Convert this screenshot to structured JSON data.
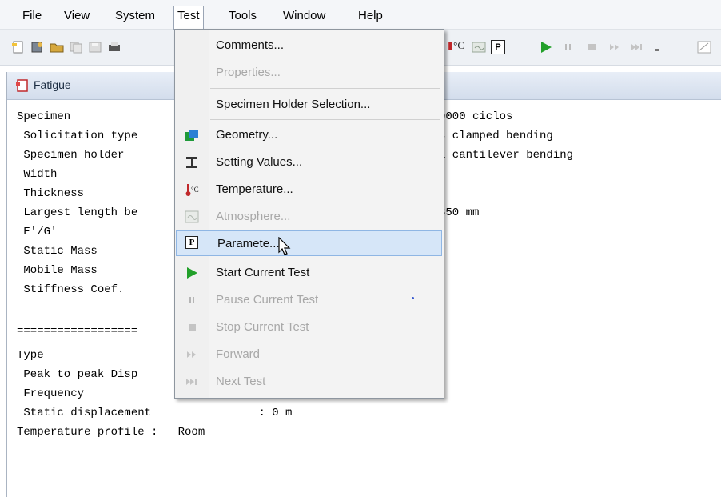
{
  "menubar": {
    "items": [
      "File",
      "View",
      "System",
      "Test",
      "Tools",
      "Window",
      "Help"
    ]
  },
  "document": {
    "title": "Fatigue",
    "lines": [
      "Specimen",
      " Solicitation type",
      " Specimen holder",
      " Width",
      " Thickness",
      " Largest length be",
      " E'/G'",
      " Static Mass",
      " Mobile Mass",
      " Stiffness Coef."
    ],
    "right_lines": [
      "0000 ciclos",
      "s clamped bending",
      "l cantilever bending",
      "",
      "",
      "350 mm"
    ],
    "separator": "==================",
    "lines2": [
      "Type",
      " Peak to peak Disp",
      " Frequency",
      " Static displacement                : 0 m",
      "Temperature profile :   Room"
    ]
  },
  "test_menu": {
    "items": [
      {
        "label": "Comments...",
        "disabled": false,
        "icon": ""
      },
      {
        "label": "Properties...",
        "disabled": true,
        "icon": ""
      },
      {
        "label": "Specimen Holder Selection...",
        "disabled": false,
        "icon": ""
      },
      {
        "label": "Geometry...",
        "disabled": false,
        "icon": "geometry-icon"
      },
      {
        "label": "Setting Values...",
        "disabled": false,
        "icon": "setting-values-icon"
      },
      {
        "label": "Temperature...",
        "disabled": false,
        "icon": "thermometer-icon"
      },
      {
        "label": "Atmosphere...",
        "disabled": true,
        "icon": "atmosphere-icon"
      },
      {
        "label": "Paramete...",
        "disabled": false,
        "icon": "parameters-icon",
        "highlighted": true
      },
      {
        "label": "Start Current Test",
        "disabled": false,
        "icon": "play-icon"
      },
      {
        "label": "Pause Current Test",
        "disabled": true,
        "icon": "pause-icon"
      },
      {
        "label": "Stop Current Test",
        "disabled": true,
        "icon": "stop-icon"
      },
      {
        "label": "Forward",
        "disabled": true,
        "icon": "forward-icon"
      },
      {
        "label": "Next Test",
        "disabled": true,
        "icon": "next-icon"
      }
    ]
  },
  "toolbar": {
    "thermo_label": "°C",
    "param_label": "P"
  },
  "colors": {
    "accent_green": "#22a02a",
    "highlight": "#d6e6f8"
  }
}
